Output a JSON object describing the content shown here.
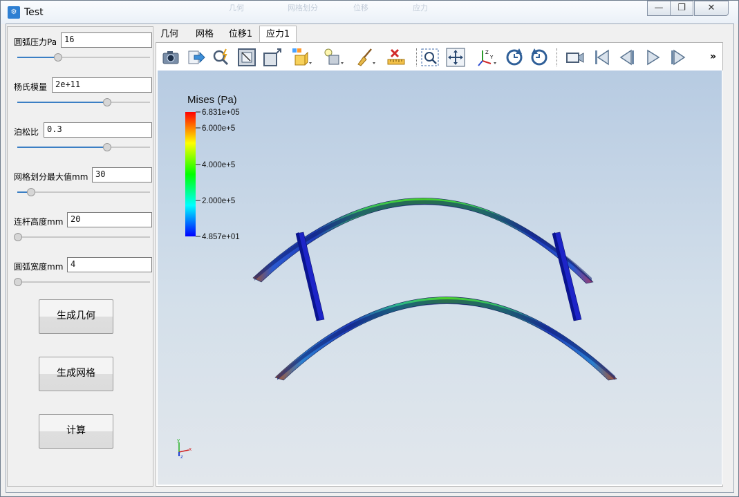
{
  "window": {
    "title": "Test",
    "app_icon_text": "⚙"
  },
  "background_tabs": [
    "几何",
    "网格划分",
    "位移",
    "应力"
  ],
  "controls": {
    "minimize": "—",
    "maximize": "❐",
    "close": "✕"
  },
  "params": [
    {
      "label": "圆弧压力Pa",
      "value": "16",
      "slider": 0.3
    },
    {
      "label": "杨氏模量",
      "value": "2e+11",
      "slider": 0.67
    },
    {
      "label": "泊松比",
      "value": "0.3",
      "slider": 0.67
    },
    {
      "label": "网格划分最大值mm",
      "value": "30",
      "slider": 0.1
    },
    {
      "label": "连杆高度mm",
      "value": "20",
      "slider": 0.0
    },
    {
      "label": "圆弧宽度mm",
      "value": "4",
      "slider": 0.0
    }
  ],
  "buttons": {
    "geometry": "生成几何",
    "mesh": "生成网格",
    "compute": "计算"
  },
  "tabs": [
    {
      "label": "几何",
      "active": false
    },
    {
      "label": "网格",
      "active": false
    },
    {
      "label": "位移1",
      "active": false
    },
    {
      "label": "应力1",
      "active": true
    }
  ],
  "toolbar": [
    {
      "name": "screenshot-icon"
    },
    {
      "name": "export-icon"
    },
    {
      "name": "pick-icon"
    },
    {
      "name": "fit-frame-icon"
    },
    {
      "name": "box-view-icon"
    },
    {
      "name": "color-box-icon"
    },
    {
      "name": "bulb-box-icon"
    },
    {
      "name": "broom-icon"
    },
    {
      "name": "ruler-x-icon"
    },
    {
      "name": "zoom-select-icon"
    },
    {
      "name": "move-icon"
    },
    {
      "name": "axes-icon"
    },
    {
      "name": "rotate-cw-icon"
    },
    {
      "name": "rotate-ccw-icon"
    },
    {
      "name": "camera-icon"
    },
    {
      "name": "first-frame-icon"
    },
    {
      "name": "prev-frame-icon"
    },
    {
      "name": "play-icon"
    },
    {
      "name": "last-frame-icon"
    }
  ],
  "toolbar_overflow": "»",
  "legend": {
    "title": "Mises (Pa)",
    "ticks": [
      "6.831e+05",
      "6.000e+5",
      "4.000e+5",
      "2.000e+5",
      "4.857e+01"
    ],
    "colors": [
      "#ff0000",
      "#ffff00",
      "#00ff00",
      "#00ffff",
      "#0000ff"
    ]
  },
  "axes_labels": [
    "y",
    "x",
    "z"
  ]
}
